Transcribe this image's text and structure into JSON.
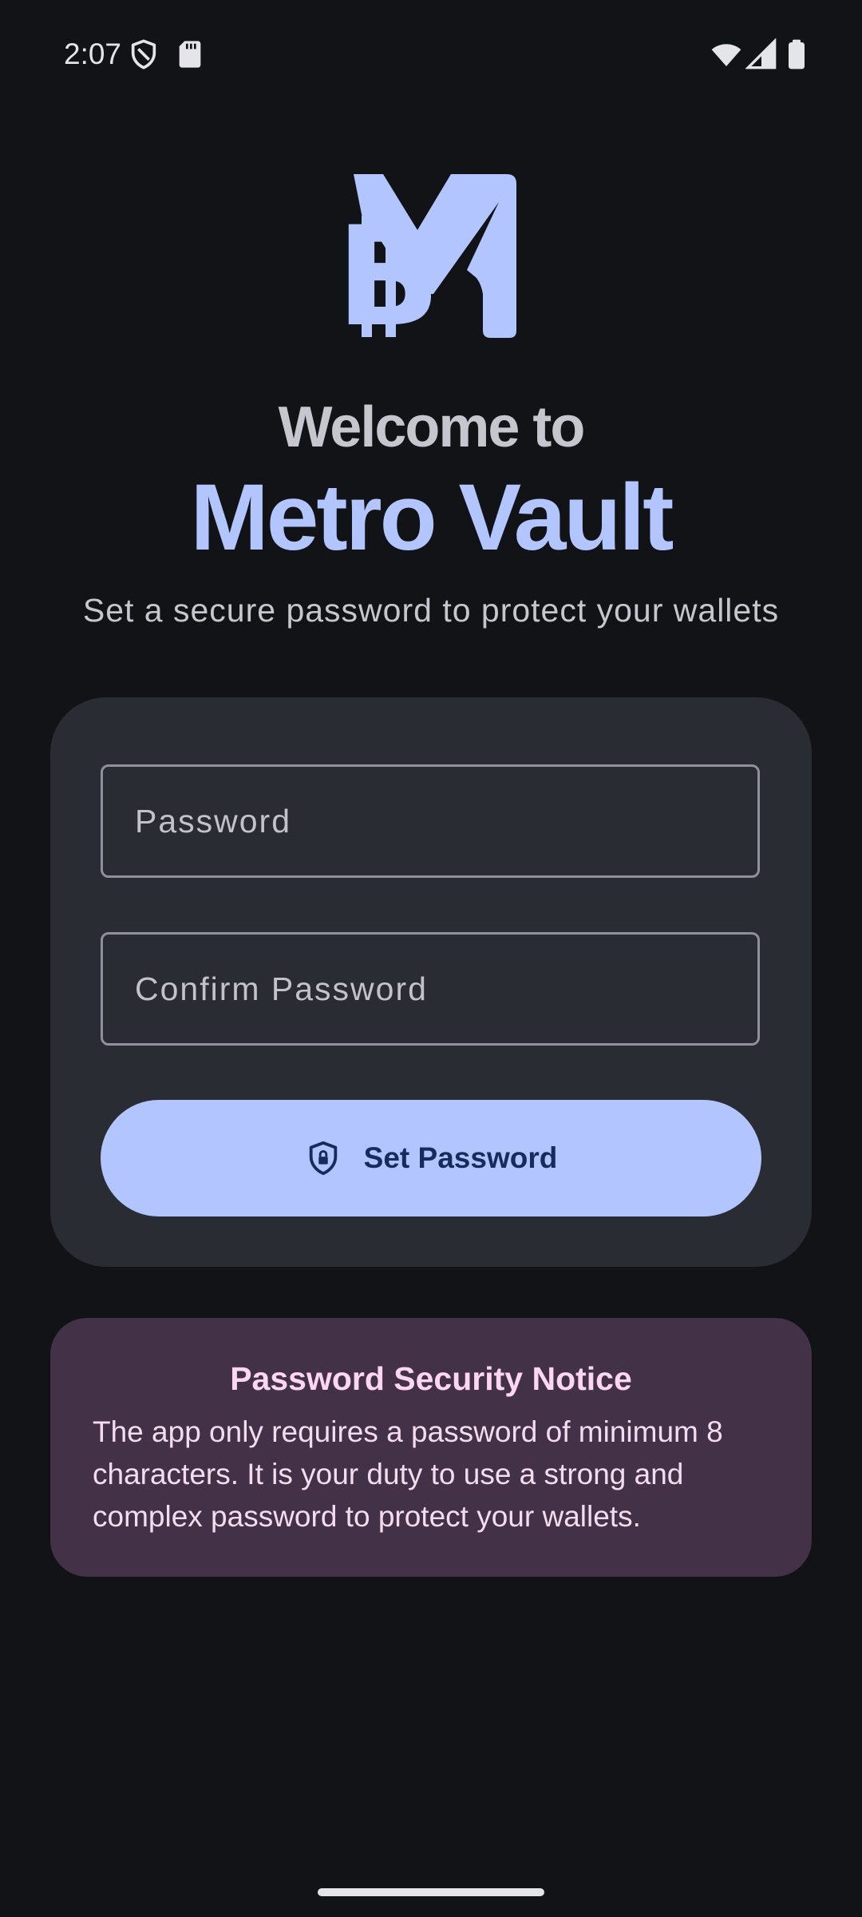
{
  "status_bar": {
    "time": "2:07",
    "icons": [
      "shield-icon",
      "sd-card-icon",
      "wifi-icon",
      "cell-signal-icon",
      "battery-icon"
    ]
  },
  "logo": {
    "icon": "metro-vault-logo-icon"
  },
  "header": {
    "welcome": "Welcome to",
    "app_name": "Metro Vault",
    "subtitle": "Set a secure password to protect your wallets"
  },
  "form": {
    "password_placeholder": "Password",
    "password_value": "",
    "confirm_placeholder": "Confirm Password",
    "confirm_value": "",
    "submit_label": "Set Password",
    "submit_icon": "shield-lock-icon"
  },
  "notice": {
    "title": "Password Security Notice",
    "body": "The app only requires a password of minimum 8 characters. It is your duty to use a strong and complex password to protect your wallets."
  },
  "colors": {
    "background": "#111317",
    "primary": "#b2c5ff",
    "card": "#2a2c33",
    "notice_card": "#433148",
    "notice_title": "#fcd6f4",
    "on_primary": "#172c5c"
  }
}
